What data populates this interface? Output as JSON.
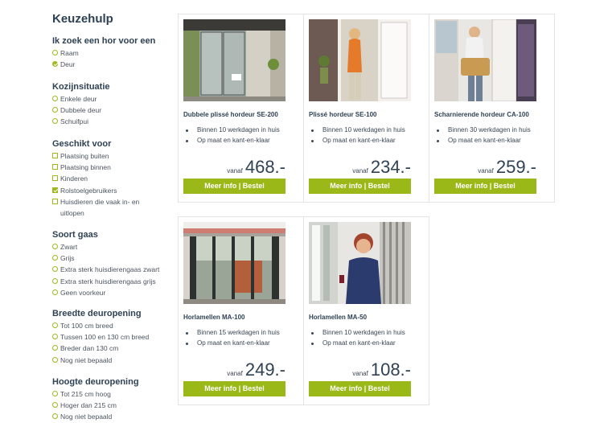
{
  "sidebar": {
    "title": "Keuzehulp",
    "sections": [
      {
        "heading": "Ik zoek een hor voor een",
        "type": "radio",
        "options": [
          {
            "label": "Raam",
            "checked": false
          },
          {
            "label": "Deur",
            "checked": true
          }
        ]
      },
      {
        "heading": "Kozijnsituatie",
        "type": "radio",
        "options": [
          {
            "label": "Enkele deur",
            "checked": false
          },
          {
            "label": "Dubbele deur",
            "checked": false
          },
          {
            "label": "Schuifpui",
            "checked": false
          }
        ]
      },
      {
        "heading": "Geschikt voor",
        "type": "checkbox",
        "options": [
          {
            "label": "Plaatsing buiten",
            "checked": false
          },
          {
            "label": "Plaatsing binnen",
            "checked": false
          },
          {
            "label": "Kinderen",
            "checked": false
          },
          {
            "label": "Rolstoelgebruikers",
            "checked": true
          },
          {
            "label": "Huisdieren die vaak in- en uitlopen",
            "checked": false
          }
        ]
      },
      {
        "heading": "Soort gaas",
        "type": "radio",
        "options": [
          {
            "label": "Zwart",
            "checked": false
          },
          {
            "label": "Grijs",
            "checked": false
          },
          {
            "label": "Extra sterk huisdierengaas zwart",
            "checked": false
          },
          {
            "label": "Extra sterk huisdierengaas grijs",
            "checked": false
          },
          {
            "label": "Geen voorkeur",
            "checked": false
          }
        ]
      },
      {
        "heading": "Breedte deuropening",
        "type": "radio",
        "options": [
          {
            "label": "Tot 100 cm breed",
            "checked": false
          },
          {
            "label": "Tussen 100 en 130 cm breed",
            "checked": false
          },
          {
            "label": "Breder dan 130 cm",
            "checked": false
          },
          {
            "label": "Nog niet bepaald",
            "checked": false
          }
        ]
      },
      {
        "heading": "Hoogte deuropening",
        "type": "radio",
        "options": [
          {
            "label": "Tot 215 cm hoog",
            "checked": false
          },
          {
            "label": "Hoger dan 215 cm",
            "checked": false
          },
          {
            "label": "Nog niet bepaald",
            "checked": false
          }
        ]
      }
    ]
  },
  "products": [
    {
      "name": "Dubbele plissé hordeur SE-200",
      "features": [
        "Binnen 10 werkdagen in huis",
        "Op maat en kant-en-klaar"
      ],
      "price_prefix": "vanaf",
      "price": "468.-",
      "cta": "Meer info | Bestel",
      "image": "double-door-patio-photo"
    },
    {
      "name": "Plissé hordeur SE-100",
      "features": [
        "Binnen 10 werkdagen in huis",
        "Op maat en kant-en-klaar"
      ],
      "price_prefix": "vanaf",
      "price": "234.-",
      "cta": "Meer info | Bestel",
      "image": "woman-at-door-photo"
    },
    {
      "name": "Scharnierende hordeur CA-100",
      "features": [
        "Binnen 30 werkdagen in huis",
        "Op maat en kant-en-klaar"
      ],
      "price_prefix": "vanaf",
      "price": "259.-",
      "cta": "Meer info | Bestel",
      "image": "man-with-basket-photo"
    },
    {
      "name": "Horlamellen MA-100",
      "features": [
        "Binnen 15 werkdagen in huis",
        "Op maat en kant-en-klaar"
      ],
      "price_prefix": "vanaf",
      "price": "249.-",
      "cta": "Meer info | Bestel",
      "image": "strip-curtain-door-photo"
    },
    {
      "name": "Horlamellen MA-50",
      "features": [
        "Binnen 10 werkdagen in huis",
        "Op maat en kant-en-klaar"
      ],
      "price_prefix": "vanaf",
      "price": "108.-",
      "cta": "Meer info | Bestel",
      "image": "woman-with-wine-photo"
    }
  ],
  "colors": {
    "accent": "#9ab817",
    "heading": "#2f4154",
    "border": "#e3e3e3"
  }
}
